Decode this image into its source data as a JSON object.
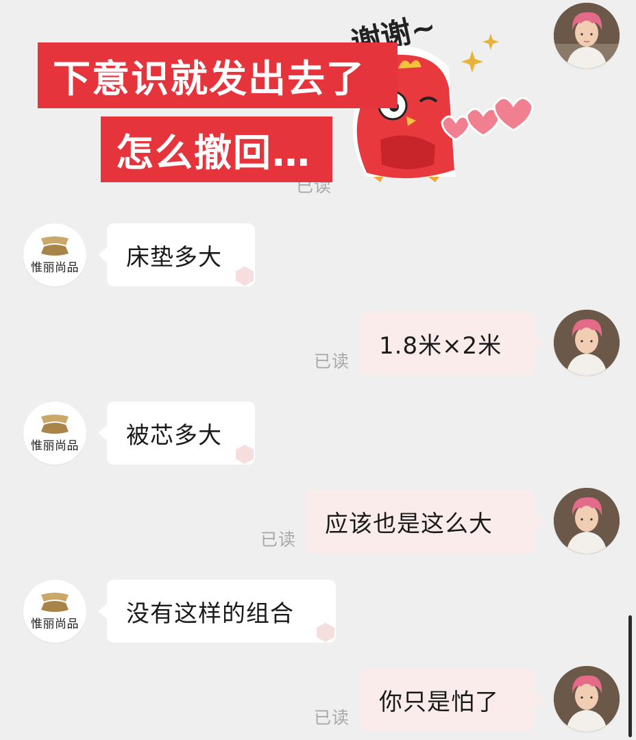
{
  "caption": {
    "line1": "下意识就发出去了",
    "line2": "怎么撤回…"
  },
  "sticker": {
    "text": "谢谢~"
  },
  "shop": {
    "name": "惟丽尚品"
  },
  "messages": [
    {
      "side": "in",
      "text": "床垫多大"
    },
    {
      "side": "out",
      "text": "1.8米×2米",
      "status": "已读"
    },
    {
      "side": "in",
      "text": "被芯多大"
    },
    {
      "side": "out",
      "text": "应该也是这么大",
      "status": "已读"
    },
    {
      "side": "in",
      "text": "没有这样的组合"
    },
    {
      "side": "out",
      "text": "你只是怕了",
      "status": "已读"
    }
  ],
  "top_status": "已读",
  "colors": {
    "background": "#efefef",
    "outgoing_bubble": "#fbecec",
    "incoming_bubble": "#ffffff",
    "caption_red": "#e5343b",
    "read_gray": "#a8a8a8"
  }
}
